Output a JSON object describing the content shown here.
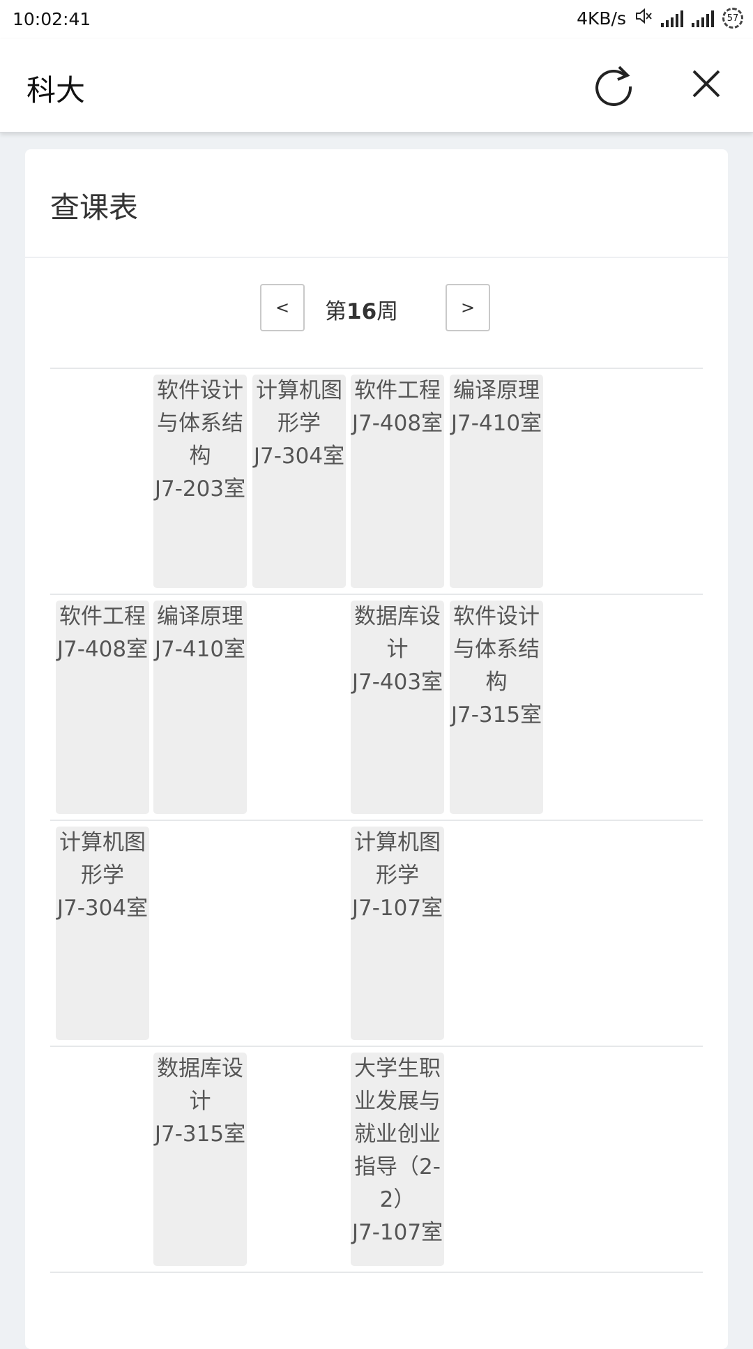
{
  "status_bar": {
    "time": "10:02:41",
    "net_speed": "4KB/s",
    "net_type": "4G",
    "battery": "57"
  },
  "app_bar": {
    "title": "科大"
  },
  "page": {
    "title": "查课表",
    "week_prefix": "第",
    "week_number": "16",
    "week_suffix": "周",
    "prev_label": "<",
    "next_label": ">"
  },
  "timetable": [
    [
      {
        "col": 1,
        "course": "软件设计与体系结构",
        "room": "J7-203室"
      },
      {
        "col": 2,
        "course": "计算机图形学",
        "room": "J7-304室"
      },
      {
        "col": 3,
        "course": "软件工程",
        "room": "J7-408室"
      },
      {
        "col": 4,
        "course": "编译原理",
        "room": "J7-410室"
      }
    ],
    [
      {
        "col": 0,
        "course": "软件工程",
        "room": "J7-408室"
      },
      {
        "col": 1,
        "course": "编译原理",
        "room": "J7-410室"
      },
      {
        "col": 3,
        "course": "数据库设计",
        "room": "J7-403室"
      },
      {
        "col": 4,
        "course": "软件设计与体系结构",
        "room": "J7-315室"
      }
    ],
    [
      {
        "col": 0,
        "course": "计算机图形学",
        "room": "J7-304室"
      },
      {
        "col": 3,
        "course": "计算机图形学",
        "room": "J7-107室"
      }
    ],
    [
      {
        "col": 1,
        "course": "数据库设计",
        "room": "J7-315室"
      },
      {
        "col": 3,
        "course": "大学生职业发展与就业创业指导（2-2）",
        "room": "J7-107室"
      }
    ]
  ]
}
